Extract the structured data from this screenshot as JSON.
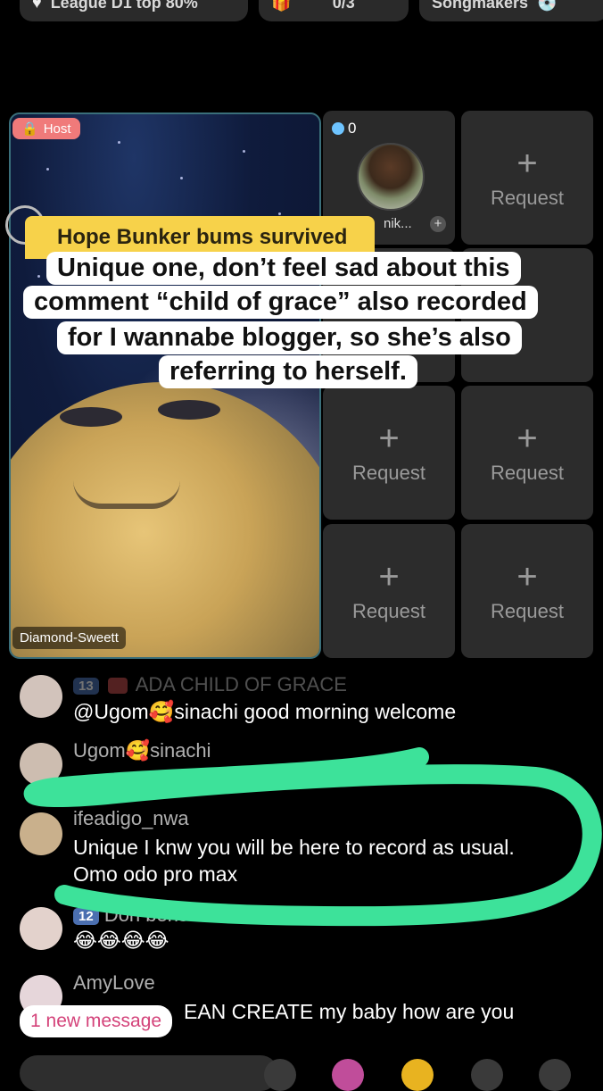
{
  "topbar": {
    "league": "League D1 top 80%",
    "count": "0/3",
    "songmakers": "Songmakers"
  },
  "host": {
    "badge": "Host",
    "name": "Diamond-Sweett"
  },
  "seat": {
    "count": "0",
    "name": "nik...",
    "plus": "+"
  },
  "request": {
    "plus": "+",
    "label": "Request"
  },
  "banner": "Hope Bunker bums survived",
  "caption": [
    "Unique one, don’t feel sad about this",
    "comment “child of grace” also recorded",
    "for I wannabe blogger, so she’s also",
    "referring to herself."
  ],
  "chat": [
    {
      "level": "13",
      "user": "ADA CHILD OF GRACE",
      "text": "@Ugom🥰sinachi good morning welcome"
    },
    {
      "user": "Ugom🥰sinachi"
    },
    {
      "user": "ifeadigo_nwa",
      "text1": "Unique I knw you will be here to record as usual.",
      "text2": "Omo odo pro max"
    },
    {
      "level": "12",
      "user": "Don bens",
      "text": "😂😂😂😂"
    },
    {
      "user": "AmyLove",
      "text": "EAN CREATE my baby how are you"
    }
  ],
  "new_message": "1 new message",
  "colors": {
    "scribble": "#3de29a",
    "banner": "#f7d24a"
  }
}
